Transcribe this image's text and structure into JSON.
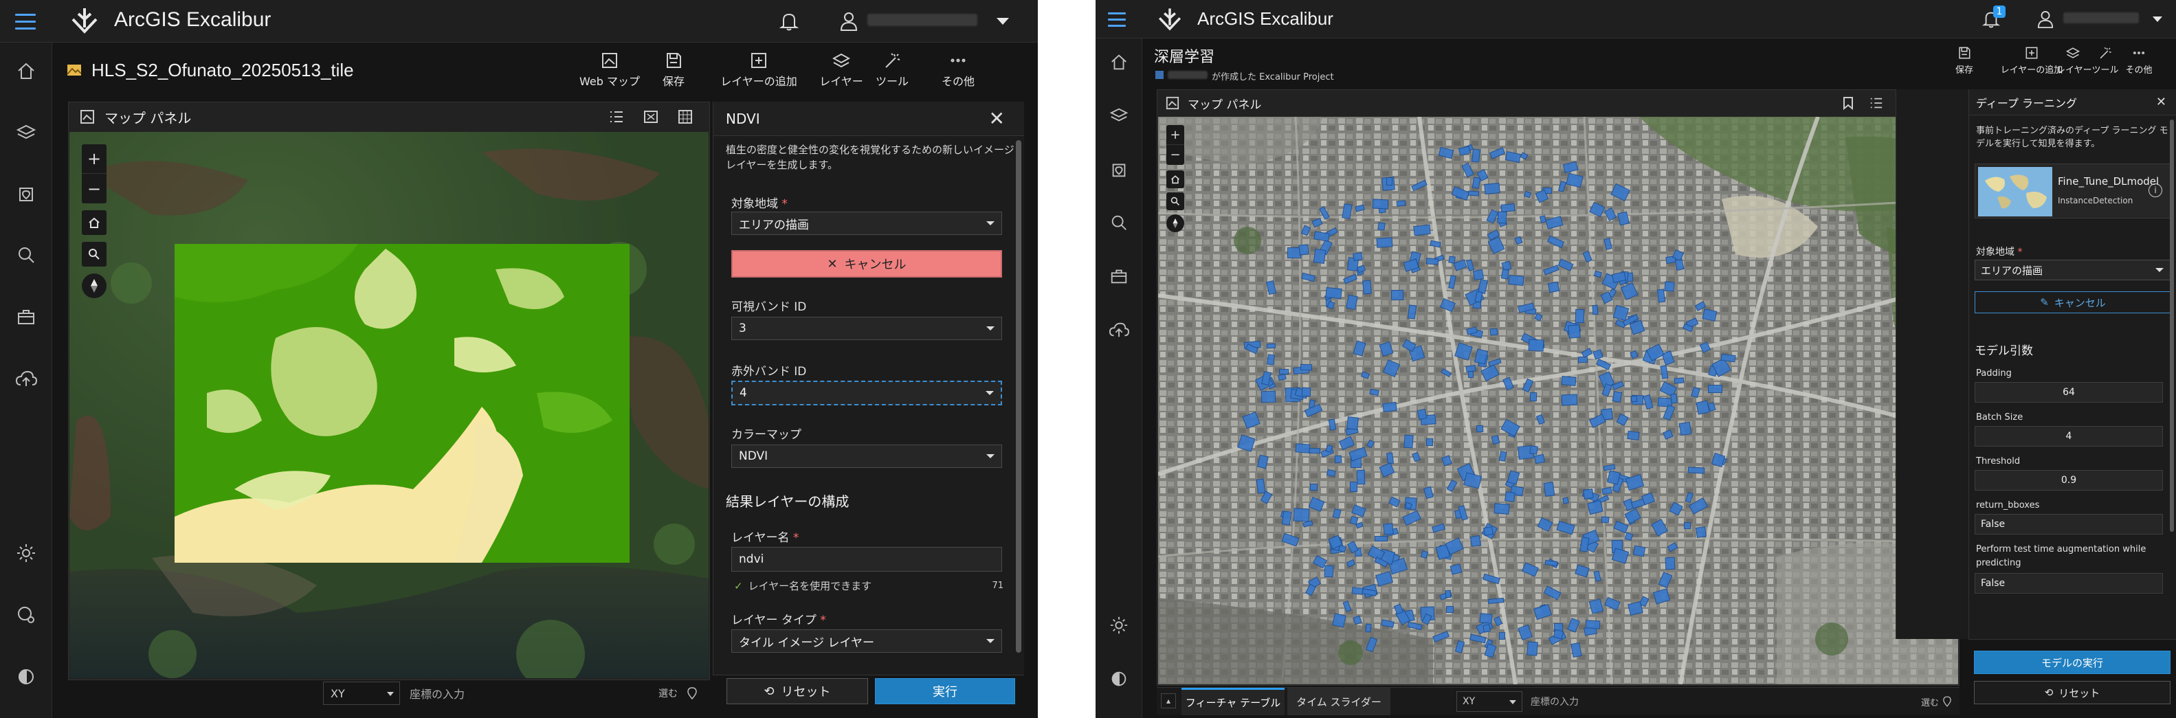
{
  "app": {
    "title": "ArcGIS Excalibur"
  },
  "left": {
    "header": {
      "title": "HLS_S2_Ofunato_20250513_tile"
    },
    "toolbar": [
      {
        "label": "Web マップ",
        "icon": "web-map-icon"
      },
      {
        "label": "保存",
        "icon": "save-icon"
      },
      {
        "label": "レイヤーの追加",
        "icon": "add-layer-icon"
      },
      {
        "label": "レイヤー",
        "icon": "layers-icon"
      },
      {
        "label": "ツール",
        "icon": "wand-icon"
      },
      {
        "label": "その他",
        "icon": "more-icon"
      }
    ],
    "map_panel": {
      "title": "マップ パネル"
    },
    "coord": {
      "system": "XY",
      "placeholder": "座標の入力",
      "action": "選む"
    },
    "tool_panel": {
      "title": "NDVI",
      "description": "植生の密度と健全性の変化を視覚化するための新しいイメージ レイヤーを生成します。",
      "area_label": "対象地域",
      "area_value": "エリアの描画",
      "cancel_label": "キャンセル",
      "visible_band_label": "可視バンド ID",
      "visible_band_value": "3",
      "infrared_band_label": "赤外バンド ID",
      "infrared_band_value": "4",
      "colormap_label": "カラーマップ",
      "colormap_value": "NDVI",
      "result_section": "結果レイヤーの構成",
      "layer_name_label": "レイヤー名",
      "layer_name_value": "ndvi",
      "layer_name_hint": "レイヤー名を使用できます",
      "layer_name_count": "71",
      "layer_type_label": "レイヤー タイプ",
      "layer_type_value": "タイル イメージ レイヤー",
      "reset_label": "リセット",
      "run_label": "実行"
    }
  },
  "right": {
    "header": {
      "title": "深層学習",
      "subtitle": "が作成した Excalibur Project"
    },
    "notification_count": "1",
    "toolbar": [
      {
        "label": "保存",
        "icon": "save-icon"
      },
      {
        "label": "レイヤーの追加",
        "icon": "add-layer-icon"
      },
      {
        "label": "レイヤー",
        "icon": "layers-icon"
      },
      {
        "label": "ツール",
        "icon": "wand-icon"
      },
      {
        "label": "その他",
        "icon": "more-icon"
      }
    ],
    "map_panel": {
      "title": "マップ パネル"
    },
    "coord": {
      "system": "XY",
      "placeholder": "座標の入力",
      "action": "選む"
    },
    "bottom_tabs": [
      "フィーチャ テーブル",
      "タイム スライダー"
    ],
    "tool_panel": {
      "title": "ディープ ラーニング",
      "description": "事前トレーニング済みのディープ ラーニング モデルを実行して知見を得ます。",
      "model_name": "Fine_Tune_DLmodel",
      "model_type": "InstanceDetection",
      "area_label": "対象地域",
      "area_value": "エリアの描画",
      "cancel_label": "キャンセル",
      "args_title": "モデル引数",
      "args": [
        {
          "label": "Padding",
          "value": "64"
        },
        {
          "label": "Batch Size",
          "value": "4"
        },
        {
          "label": "Threshold",
          "value": "0.9"
        },
        {
          "label": "return_bboxes",
          "value": "False"
        },
        {
          "label": "Perform test time augmentation while predicting",
          "value": "False"
        }
      ],
      "run_label": "モデルの実行",
      "reset_label": "リセット"
    }
  },
  "colors": {
    "accent": "#2a9df4",
    "ndvi_green": "#3f9a07",
    "ndvi_low": "#f7e7a5",
    "cancel_red": "#f08080",
    "building_blue": "#3a78c9"
  }
}
